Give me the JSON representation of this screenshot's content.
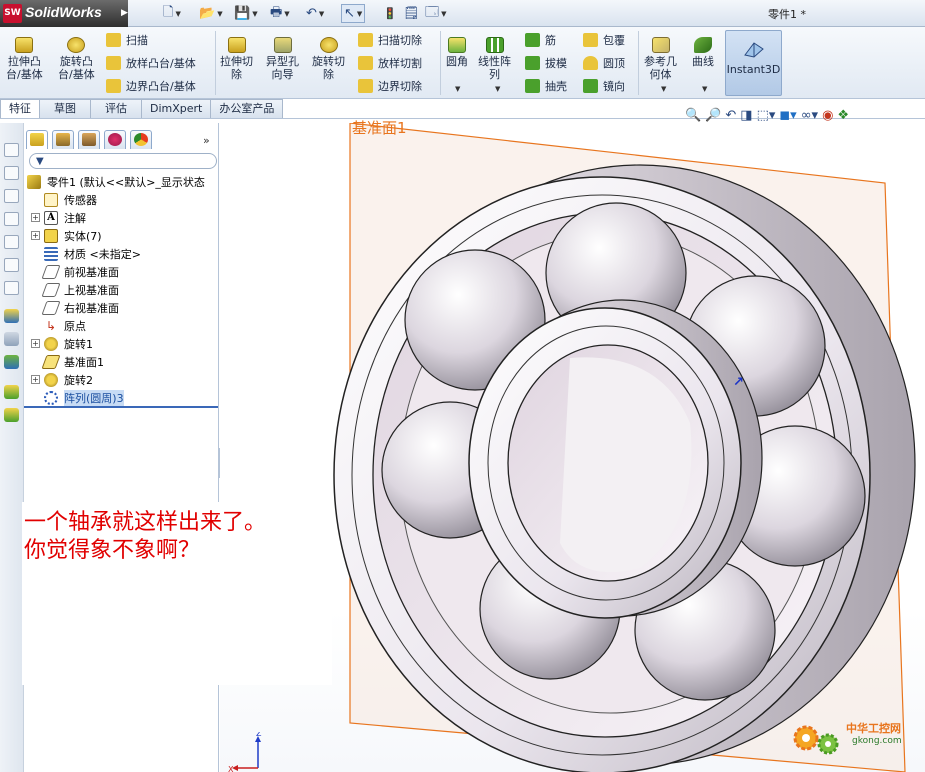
{
  "app": {
    "name": "SolidWorks",
    "logo_short": "SW",
    "document_title": "零件1 *"
  },
  "ribbon": {
    "big_buttons": [
      {
        "id": "extrude-boss",
        "label_l1": "拉伸凸",
        "label_l2": "台/基体",
        "icon": "extrude-boss-icon"
      },
      {
        "id": "revolve-boss",
        "label_l1": "旋转凸",
        "label_l2": "台/基体",
        "icon": "revolve-boss-icon"
      },
      {
        "id": "extrude-cut",
        "label_l1": "拉伸切",
        "label_l2": "除",
        "icon": "extrude-cut-icon"
      },
      {
        "id": "hole-wizard",
        "label_l1": "异型孔",
        "label_l2": "向导",
        "icon": "hole-wizard-icon"
      },
      {
        "id": "revolve-cut",
        "label_l1": "旋转切",
        "label_l2": "除",
        "icon": "revolve-cut-icon"
      },
      {
        "id": "fillet",
        "label_l1": "圆角",
        "label_l2": "",
        "icon": "fillet-icon"
      },
      {
        "id": "linear-pattern",
        "label_l1": "线性阵",
        "label_l2": "列",
        "icon": "linear-pattern-icon"
      },
      {
        "id": "ref-geometry",
        "label_l1": "参考几",
        "label_l2": "何体",
        "icon": "reference-geometry-icon"
      },
      {
        "id": "curves",
        "label_l1": "曲线",
        "label_l2": "",
        "icon": "curves-icon"
      }
    ],
    "small_buttons": [
      {
        "id": "sweep",
        "label": "扫描",
        "icon": "sweep-icon"
      },
      {
        "id": "loft",
        "label": "放样凸台/基体",
        "icon": "loft-icon"
      },
      {
        "id": "boundary-boss",
        "label": "边界凸台/基体",
        "icon": "boundary-boss-icon"
      },
      {
        "id": "swept-cut",
        "label": "扫描切除",
        "icon": "swept-cut-icon"
      },
      {
        "id": "lofted-cut",
        "label": "放样切割",
        "icon": "lofted-cut-icon"
      },
      {
        "id": "boundary-cut",
        "label": "边界切除",
        "icon": "boundary-cut-icon"
      },
      {
        "id": "rib",
        "label": "筋",
        "icon": "rib-icon"
      },
      {
        "id": "draft",
        "label": "拔模",
        "icon": "draft-icon"
      },
      {
        "id": "shell",
        "label": "抽壳",
        "icon": "shell-icon"
      },
      {
        "id": "wrap",
        "label": "包覆",
        "icon": "wrap-icon"
      },
      {
        "id": "dome",
        "label": "圆顶",
        "icon": "dome-icon"
      },
      {
        "id": "mirror",
        "label": "镜向",
        "icon": "mirror-icon"
      }
    ],
    "instant3d_label": "Instant3D"
  },
  "tabs": [
    {
      "label": "特征",
      "active": true
    },
    {
      "label": "草图",
      "active": false
    },
    {
      "label": "评估",
      "active": false
    },
    {
      "label": "DimXpert",
      "active": false
    },
    {
      "label": "办公室产品",
      "active": false
    }
  ],
  "feature_tree": {
    "more_glyph": "»",
    "root_label": "零件1  (默认<<默认>_显示状态",
    "items": [
      {
        "label": "传感器",
        "icon": "sensor-icon",
        "expandable": false,
        "selected": false
      },
      {
        "label": "注解",
        "icon": "annotation-icon",
        "expandable": true,
        "selected": false
      },
      {
        "label": "实体(7)",
        "icon": "solid-bodies-icon",
        "expandable": true,
        "selected": false
      },
      {
        "label": "材质 <未指定>",
        "icon": "material-icon",
        "expandable": false,
        "selected": false
      },
      {
        "label": "前视基准面",
        "icon": "plane-icon",
        "expandable": false,
        "selected": false
      },
      {
        "label": "上视基准面",
        "icon": "plane-icon",
        "expandable": false,
        "selected": false
      },
      {
        "label": "右视基准面",
        "icon": "plane-icon",
        "expandable": false,
        "selected": false
      },
      {
        "label": "原点",
        "icon": "origin-icon",
        "expandable": false,
        "selected": false
      },
      {
        "label": "旋转1",
        "icon": "revolve-feature-icon",
        "expandable": true,
        "selected": false
      },
      {
        "label": "基准面1",
        "icon": "plane-yellow-icon",
        "expandable": false,
        "selected": false
      },
      {
        "label": "旋转2",
        "icon": "revolve-feature-icon",
        "expandable": true,
        "selected": false
      },
      {
        "label": "阵列(圆周)3",
        "icon": "circular-pattern-icon",
        "expandable": false,
        "selected": true
      }
    ]
  },
  "viewport": {
    "plane_label": "基准面1",
    "cursor_glyph": "↗",
    "triad": {
      "z": "Z",
      "x": "X"
    }
  },
  "note": {
    "line1": "一个轴承就这样出来了。",
    "line2": "你觉得象不象啊？",
    "color": "#e10000"
  },
  "watermark": {
    "line1": "中华工控网",
    "line2": "gkong.com"
  },
  "colors": {
    "plane": "#e8751e",
    "accent": "#3a68b8"
  }
}
